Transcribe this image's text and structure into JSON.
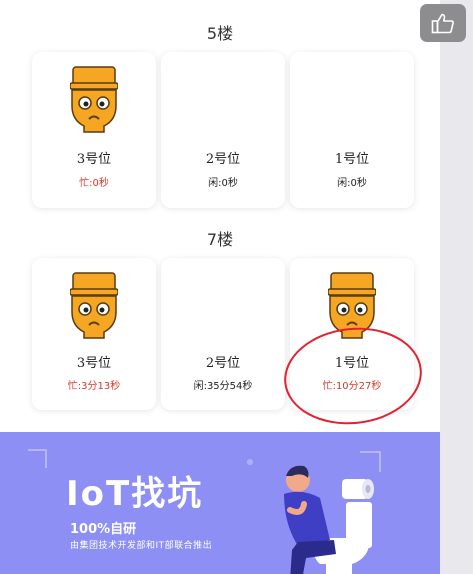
{
  "floors": [
    {
      "title": "5楼",
      "stalls": [
        {
          "label": "3号位",
          "status": "忙:0秒",
          "busy": true
        },
        {
          "label": "2号位",
          "status": "闲:0秒",
          "busy": false
        },
        {
          "label": "1号位",
          "status": "闲:0秒",
          "busy": false
        }
      ]
    },
    {
      "title": "7楼",
      "stalls": [
        {
          "label": "3号位",
          "status": "忙:3分13秒",
          "busy": true
        },
        {
          "label": "2号位",
          "status": "闲:35分54秒",
          "busy": false
        },
        {
          "label": "1号位",
          "status": "忙:10分27秒",
          "busy": true
        }
      ]
    }
  ],
  "banner": {
    "title": "IoT找坑",
    "subtitle": "100%自研",
    "caption": "由集团技术开发部和IT部联合推出"
  },
  "colors": {
    "busy": "#d53a2c",
    "idle": "#222222",
    "banner_bg": "#8e8ff5",
    "toilet_orange": "#f5a623",
    "annotation_red": "#e5202e"
  },
  "icons": {
    "like": "thumbs-up-icon",
    "occupied": "occupied-toilet-face-icon"
  }
}
